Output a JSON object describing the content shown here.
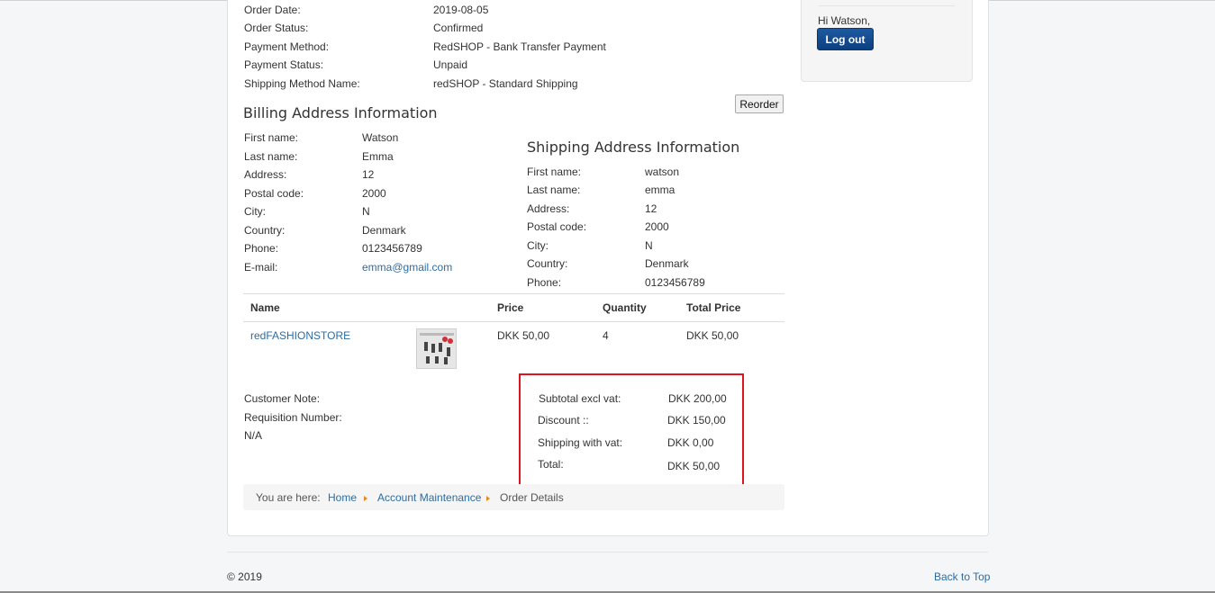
{
  "order_info": [
    {
      "label": "Order Date:",
      "value": "2019-08-05"
    },
    {
      "label": "Order Status:",
      "value": "Confirmed"
    },
    {
      "label": "Payment Method:",
      "value": "RedSHOP - Bank Transfer Payment"
    },
    {
      "label": "Payment Status:",
      "value": "Unpaid"
    },
    {
      "label": "Shipping Method Name:",
      "value": "redSHOP - Standard Shipping"
    }
  ],
  "reorder_label": "Reorder",
  "sidebar": {
    "greeting": "Hi Watson,",
    "logout_label": "Log out"
  },
  "billing": {
    "title": "Billing Address Information",
    "rows": [
      {
        "label": "First name:",
        "value": "Watson"
      },
      {
        "label": "Last name:",
        "value": "Emma"
      },
      {
        "label": "Address:",
        "value": "12"
      },
      {
        "label": "Postal code:",
        "value": "2000"
      },
      {
        "label": "City:",
        "value": "N"
      },
      {
        "label": "Country:",
        "value": "Denmark"
      },
      {
        "label": "Phone:",
        "value": "0123456789"
      },
      {
        "label": "E-mail:",
        "value": "emma@gmail.com"
      }
    ]
  },
  "shipping": {
    "title": "Shipping Address Information",
    "rows": [
      {
        "label": "First name:",
        "value": "watson"
      },
      {
        "label": "Last name:",
        "value": "emma"
      },
      {
        "label": "Address:",
        "value": "12"
      },
      {
        "label": "Postal code:",
        "value": "2000"
      },
      {
        "label": "City:",
        "value": "N"
      },
      {
        "label": "Country:",
        "value": "Denmark"
      },
      {
        "label": "Phone:",
        "value": "0123456789"
      }
    ]
  },
  "table": {
    "headers": {
      "name": "Name",
      "price": "Price",
      "quantity": "Quantity",
      "total": "Total Price"
    },
    "rows": [
      {
        "name": "redFASHIONSTORE",
        "price": "DKK 50,00",
        "quantity": "4",
        "total": "DKK 50,00"
      }
    ]
  },
  "notes": {
    "customer_note": "Customer Note:",
    "requisition": "Requisition Number:",
    "requisition_value": "N/A"
  },
  "totals": [
    {
      "label": "Subtotal excl vat:",
      "value": "DKK 200,00"
    },
    {
      "label": "Discount ::",
      "value": "DKK 150,00"
    },
    {
      "label": "Shipping with vat:",
      "value": "DKK 0,00"
    },
    {
      "label": "Total:",
      "value": "DKK 50,00"
    }
  ],
  "breadcrumb": {
    "prefix": "You are here:",
    "items": [
      "Home",
      "Account Maintenance",
      "Order Details"
    ]
  },
  "footer": {
    "copyright": "© 2019",
    "back_to_top": "Back to Top"
  },
  "colors": {
    "link": "#2d6ca2",
    "highlight_border": "#e0141e",
    "logout_button": "#0d3f80",
    "breadcrumb_arrow": "#e58b1f"
  }
}
